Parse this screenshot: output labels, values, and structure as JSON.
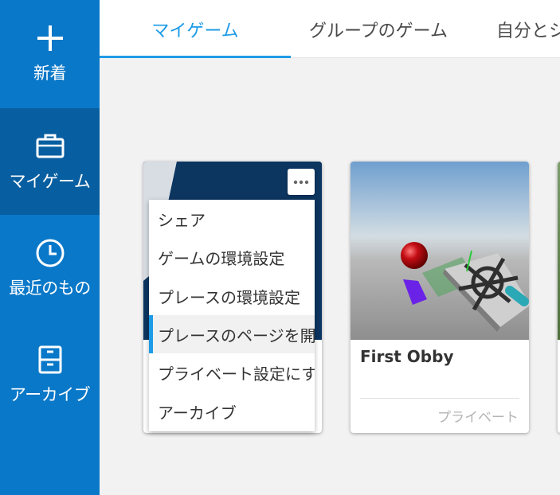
{
  "sidebar": {
    "items": [
      {
        "label": "新着",
        "icon": "plus-icon"
      },
      {
        "label": "マイゲーム",
        "icon": "briefcase-icon"
      },
      {
        "label": "最近のもの",
        "icon": "clock-icon"
      },
      {
        "label": "アーカイブ",
        "icon": "archive-box-icon"
      }
    ]
  },
  "tabs": [
    "マイゲーム",
    "グループのゲーム",
    "自分とシ"
  ],
  "context_menu": {
    "items": [
      "シェア",
      "ゲームの環境設定",
      "プレースの環境設定",
      "プレースのページを開く",
      "プライベート設定にする",
      "アーカイブ"
    ]
  },
  "games": [
    {
      "title": "First Obby",
      "status": "プライベート"
    }
  ],
  "colors": {
    "sidebar": "#0a78c8",
    "sidebar_active": "#075ea0",
    "accent": "#1d9be6",
    "page_bg": "#f2f2f2"
  }
}
